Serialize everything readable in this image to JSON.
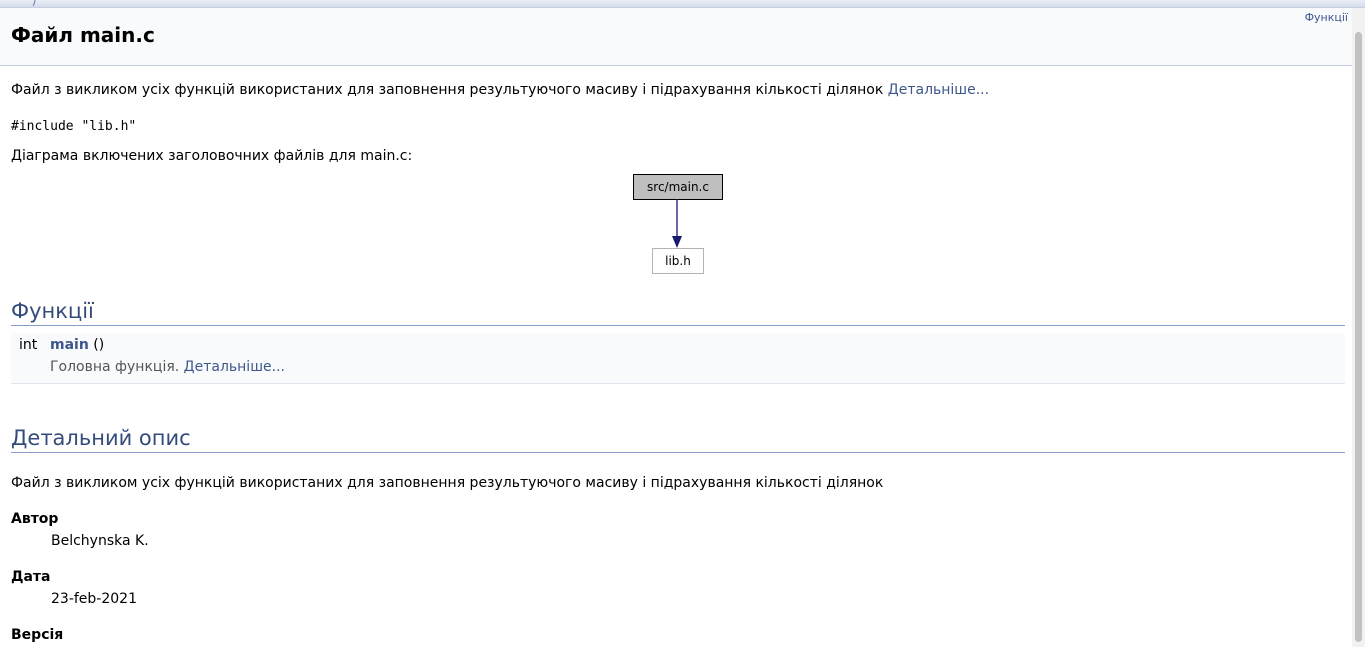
{
  "nav": {
    "summary_link": "Функції"
  },
  "header": {
    "title": "Файл main.c"
  },
  "brief": {
    "text": "Файл з викликом усіх функцій використаних для заповнення результуючого масиву і підрахування кількості ділянок",
    "more_link": "Детальніше..."
  },
  "include_line": "#include \"lib.h\"",
  "include_graph": {
    "caption": "Діаграма включених заголовочних файлів для main.c:",
    "nodes": [
      "src/main.c",
      "lib.h"
    ]
  },
  "functions": {
    "heading": "Функції",
    "items": [
      {
        "type": "int",
        "name": "main",
        "params": "()",
        "brief": "Головна функція.",
        "more_link": "Детальніше..."
      }
    ]
  },
  "details": {
    "heading": "Детальний опис",
    "text": "Файл з викликом усіх функцій використаних для заповнення результуючого масиву і підрахування кількості ділянок",
    "author_label": "Автор",
    "author": "Belchynska K.",
    "date_label": "Дата",
    "date": "23-feb-2021",
    "version_label": "Версія"
  },
  "colors": {
    "link": "#3d578c",
    "heading": "#354c7b",
    "rule": "#879ecb",
    "arrow": "#191970"
  }
}
